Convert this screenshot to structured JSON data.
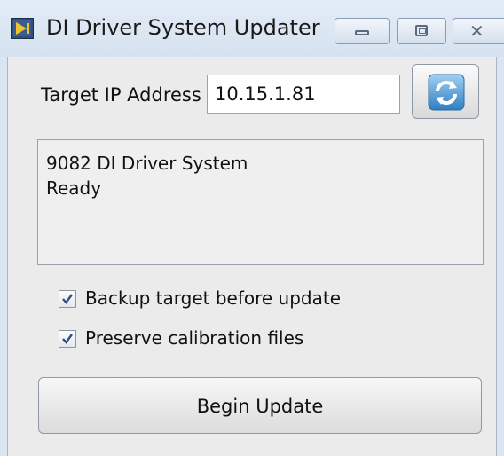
{
  "window": {
    "title": "DI Driver System Updater"
  },
  "target": {
    "label": "Target IP Address",
    "ip_value": "10.15.1.81"
  },
  "status": {
    "lines": [
      "9082 DI Driver System",
      "Ready"
    ]
  },
  "options": [
    {
      "label": "Backup target before update",
      "checked": true
    },
    {
      "label": "Preserve calibration files",
      "checked": true
    }
  ],
  "actions": {
    "begin_label": "Begin Update"
  },
  "icons": {
    "app": "labview-app-icon",
    "refresh": "refresh-icon",
    "minimize": "minimize-icon",
    "maximize": "maximize-icon",
    "close": "close-icon",
    "check": "check-icon"
  }
}
